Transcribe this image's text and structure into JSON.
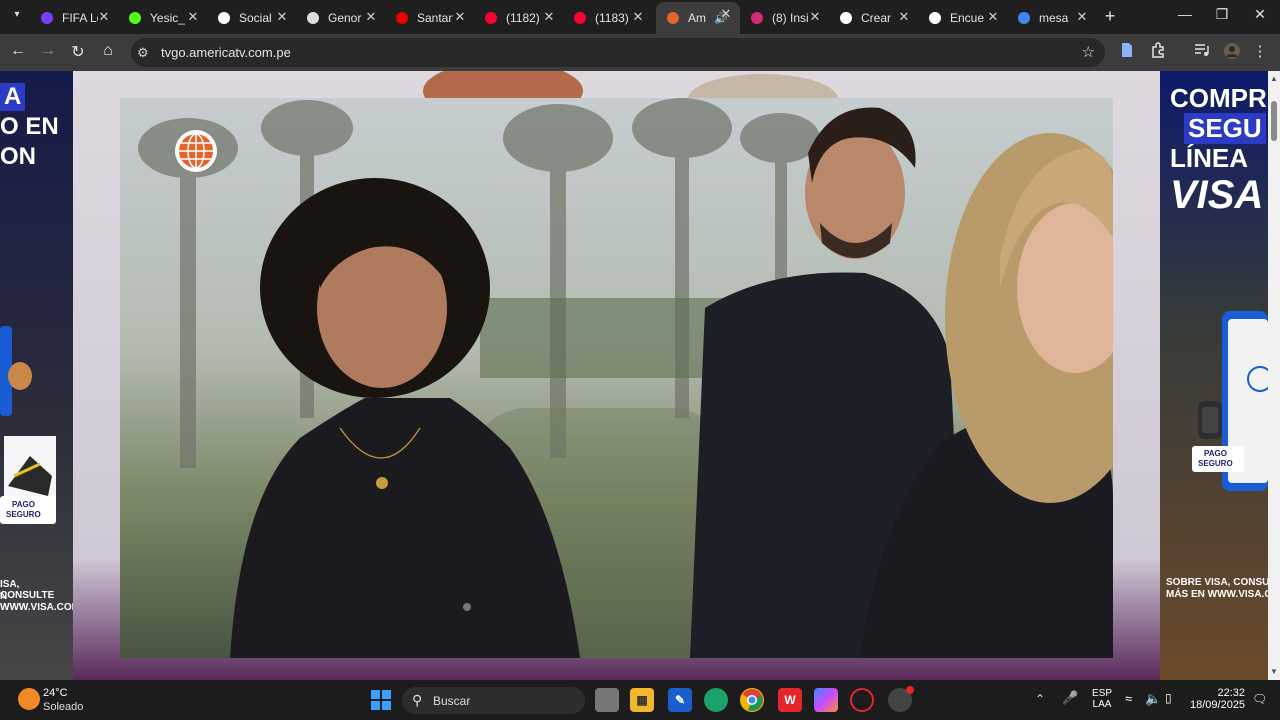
{
  "browser": {
    "tabs": [
      {
        "title": "FIFA Lo",
        "icon": "fifa-heart-icon",
        "color": "#7a3cff"
      },
      {
        "title": "Yesic_",
        "icon": "kick-k-icon",
        "color": "#53fc18"
      },
      {
        "title": "Social",
        "icon": "globe-icon",
        "color": "#ffffff"
      },
      {
        "title": "Genor",
        "icon": "genome-icon",
        "color": "#dddddd"
      },
      {
        "title": "Santan",
        "icon": "santander-flame-icon",
        "color": "#ec0000"
      },
      {
        "title": "(1182)",
        "icon": "youtube-icon",
        "color": "#ff0033"
      },
      {
        "title": "(1183)",
        "icon": "youtube-icon",
        "color": "#ff0033"
      },
      {
        "title": "Am",
        "icon": "america-globe-icon",
        "color": "#e8622a",
        "active": true
      },
      {
        "title": "(8) Insi",
        "icon": "instagram-icon",
        "color": "#d62976"
      },
      {
        "title": "Crear",
        "icon": "openai-icon",
        "color": "#ffffff"
      },
      {
        "title": "Encue",
        "icon": "tiktok-icon",
        "color": "#ffffff"
      },
      {
        "title": "mesa",
        "icon": "google-icon",
        "color": "#4285f4"
      }
    ],
    "url": "tvgo.americatv.com.pe"
  },
  "page": {
    "left_ad": {
      "lines": [
        "A",
        "O EN",
        "ON"
      ],
      "pago": "PAGO",
      "seguro": "SEGURO",
      "footer1": "ISA, CONSULTE",
      "footer2": "N WWW.VISA.COM"
    },
    "right_ad": {
      "line1": "COMPR",
      "line2": "SEGU",
      "line3": "LÍNEA",
      "visa": "VISA",
      "pago": "PAGO",
      "seguro": "SEGURO",
      "footer1": "SOBRE VISA, CONSUL",
      "footer2": "MÁS EN WWW.VISA.CO"
    },
    "colors": {
      "brand": "#e8622a",
      "visa_blue": "#1a1f71"
    }
  },
  "taskbar": {
    "weather_temp": "24°C",
    "weather_desc": "Soleado",
    "search_placeholder": "Buscar",
    "lang1": "ESP",
    "lang2": "LAA",
    "time": "22:32",
    "date": "18/09/2025"
  }
}
